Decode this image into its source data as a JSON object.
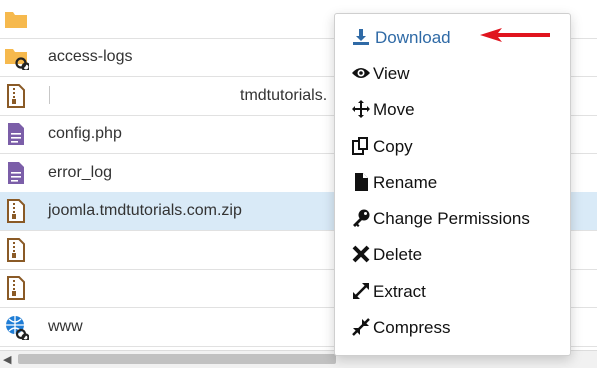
{
  "files": [
    {
      "name": "",
      "type": "folder"
    },
    {
      "name": "access-logs",
      "type": "folder-link"
    },
    {
      "name": "tmdtutorials.",
      "type": "zip"
    },
    {
      "name": "config.php",
      "type": "text"
    },
    {
      "name": "error_log",
      "type": "text"
    },
    {
      "name": "joomla.tmdtutorials.com.zip",
      "type": "zip",
      "selected": true
    },
    {
      "name": "",
      "type": "zip"
    },
    {
      "name": "",
      "type": "zip"
    },
    {
      "name": "www",
      "type": "globe-link"
    }
  ],
  "context_menu": {
    "items": [
      {
        "label": "Download",
        "icon": "download-icon"
      },
      {
        "label": "View",
        "icon": "eye-icon"
      },
      {
        "label": "Move",
        "icon": "move-icon"
      },
      {
        "label": "Copy",
        "icon": "copy-icon"
      },
      {
        "label": "Rename",
        "icon": "file-icon"
      },
      {
        "label": "Change Permissions",
        "icon": "key-icon"
      },
      {
        "label": "Delete",
        "icon": "x-icon"
      },
      {
        "label": "Extract",
        "icon": "expand-icon"
      },
      {
        "label": "Compress",
        "icon": "compress-icon"
      }
    ]
  },
  "colors": {
    "folder": "#f6b94d",
    "zip_outline": "#8a5a26",
    "text_file": "#7b5ea8",
    "selected_row": "#d9eaf7",
    "download_accent": "#2f6aa6",
    "annotation_arrow": "#e0141e"
  },
  "scrollbar": {
    "left_arrow": "◀"
  }
}
